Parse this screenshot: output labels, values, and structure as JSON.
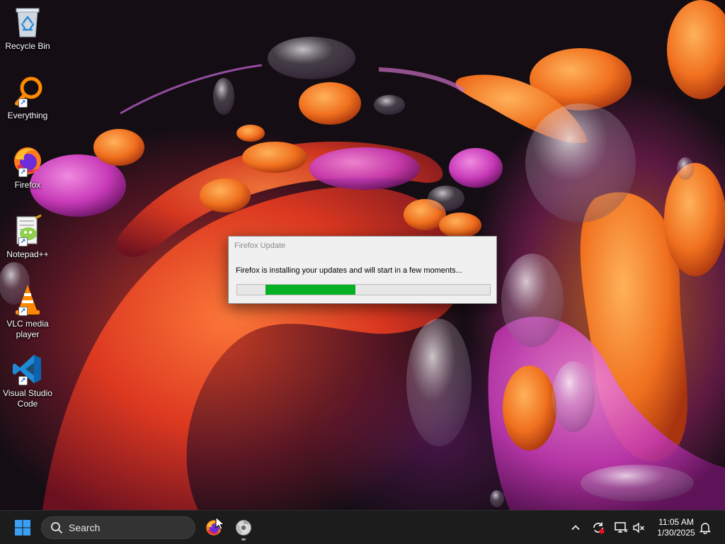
{
  "desktop": {
    "icons": [
      {
        "label": "Recycle Bin",
        "icon": "recycle-bin-icon"
      },
      {
        "label": "Everything",
        "icon": "everything-search-icon",
        "shortcut": true
      },
      {
        "label": "Firefox",
        "icon": "firefox-icon",
        "shortcut": true
      },
      {
        "label": "Notepad++",
        "icon": "notepadpp-icon",
        "shortcut": true
      },
      {
        "label": "VLC media player",
        "icon": "vlc-icon",
        "shortcut": true
      },
      {
        "label": "Visual Studio Code",
        "icon": "vscode-icon",
        "shortcut": true
      }
    ]
  },
  "dialog": {
    "title": "Firefox Update",
    "message": "Firefox is installing your updates and will start in a few moments...",
    "progress_fill_color": "#06b025"
  },
  "taskbar": {
    "search_placeholder": "Search",
    "pinned": [
      {
        "name": "Firefox",
        "icon": "firefox-icon",
        "running": false
      },
      {
        "name": "Chrome",
        "icon": "chrome-icon",
        "running": true
      }
    ],
    "tray": {
      "icons": [
        "chevron-up-icon",
        "sync-alert-icon",
        "network-icon",
        "volume-muted-icon",
        "notification-bell-icon"
      ]
    },
    "clock": {
      "time": "11:05 AM",
      "date": "1/30/2025"
    }
  },
  "colors": {
    "taskbar_bg": "#1c1c1c",
    "dialog_bg": "#f0f0f0",
    "windows_blue": "#3a9ff5"
  }
}
